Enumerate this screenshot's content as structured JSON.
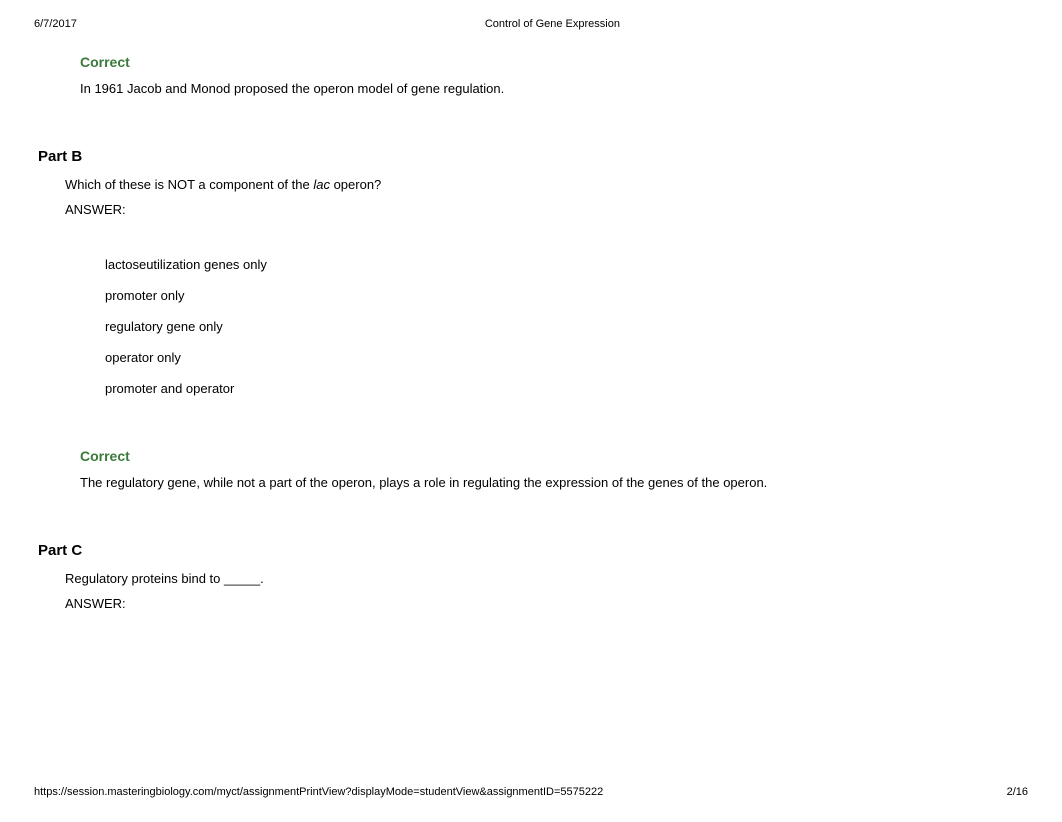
{
  "header": {
    "date": "6/7/2017",
    "title": "Control of Gene Expression"
  },
  "sectionA": {
    "correct_label": "Correct",
    "explanation": "In 1961 Jacob and Monod proposed the operon model of gene regulation."
  },
  "partB": {
    "heading": "Part B",
    "question_prefix": "Which of these is NOT a component of the ",
    "question_italic": "lac",
    "question_suffix": " operon?",
    "answer_label": "ANSWER:",
    "options": [
      "lactoseutilization genes only",
      "promoter only",
      "regulatory gene only",
      "operator only",
      "promoter and operator"
    ],
    "correct_label": "Correct",
    "explanation": "The regulatory gene, while not a part of the operon, plays a role in regulating the expression of the genes of the operon."
  },
  "partC": {
    "heading": "Part C",
    "question": "Regulatory proteins bind to _____.",
    "answer_label": "ANSWER:"
  },
  "footer": {
    "url": "https://session.masteringbiology.com/myct/assignmentPrintView?displayMode=studentView&assignmentID=5575222",
    "page": "2/16"
  }
}
